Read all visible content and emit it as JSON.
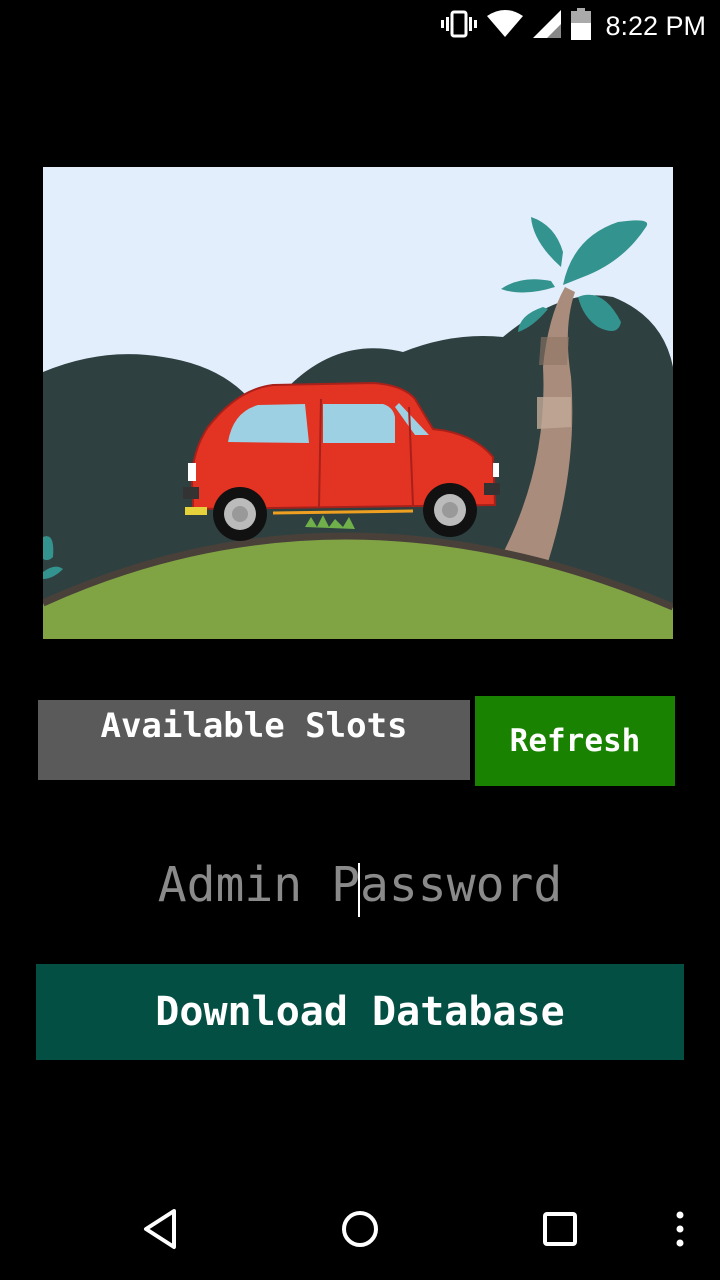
{
  "status_bar": {
    "time": "8:22 PM",
    "icons": [
      "vibrate-icon",
      "wifi-icon",
      "signal-icon",
      "battery-icon"
    ]
  },
  "hero": {
    "icon": "car-illustration",
    "colors": {
      "sky": "#e3eefc",
      "hills": "#2f4040",
      "grass": "#80a444",
      "car": "#e33322",
      "leaves": "#33938e",
      "trunk": "#a98c7b"
    }
  },
  "slots": {
    "label": "Available Slots"
  },
  "refresh_button": {
    "label": "Refresh",
    "color": "#198200"
  },
  "password_input": {
    "placeholder": "Admin Password",
    "value": ""
  },
  "download_button": {
    "label": "Download Database",
    "color": "#034f43"
  },
  "nav_bar": {
    "icons": [
      "back-icon",
      "home-icon",
      "recents-icon",
      "more-icon"
    ]
  }
}
